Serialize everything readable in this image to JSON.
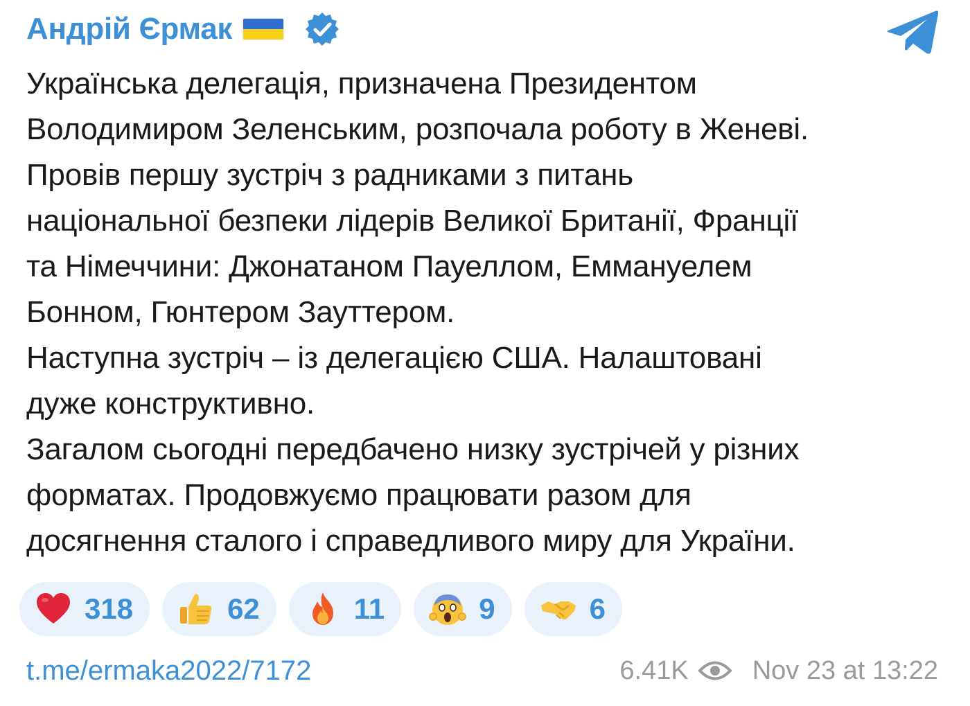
{
  "header": {
    "author": "Андрій Єрмак",
    "flag_icon": "ukraine-flag-icon",
    "verified_icon": "verified-badge-icon",
    "app_icon": "telegram-icon",
    "colors": {
      "accent": "#3d8fd6",
      "flag_blue": "#2f6fcf",
      "flag_yellow": "#f5d11c"
    }
  },
  "message": {
    "paragraphs": [
      "Українська делегація, призначена Президентом\nВолодимиром Зеленським, розпочала роботу в Женеві.",
      "Провів першу зустріч з радниками з питань\nнаціональної безпеки лідерів Великої Британії, Франції\nта Німеччини: Джонатаном Пауеллом, Еммануелем\nБонном, Гюнтером Зауттером.",
      "Наступна зустріч – із делегацією США. Налаштовані\nдуже конструктивно.",
      "Загалом сьогодні передбачено низку зустрічей у різних\nформатах. Продовжуємо працювати разом для\nдосягнення сталого і справедливого миру для України."
    ]
  },
  "reactions": [
    {
      "icon": "red-heart-icon",
      "count": "318"
    },
    {
      "icon": "thumbs-up-icon",
      "count": "62"
    },
    {
      "icon": "fire-icon",
      "count": "11"
    },
    {
      "icon": "screaming-face-icon",
      "count": "9"
    },
    {
      "icon": "handshake-icon",
      "count": "6"
    }
  ],
  "footer": {
    "link": "t.me/ermaka2022/7172",
    "views": "6.41K",
    "views_icon": "eye-icon",
    "timestamp": "Nov 23 at 13:22"
  }
}
